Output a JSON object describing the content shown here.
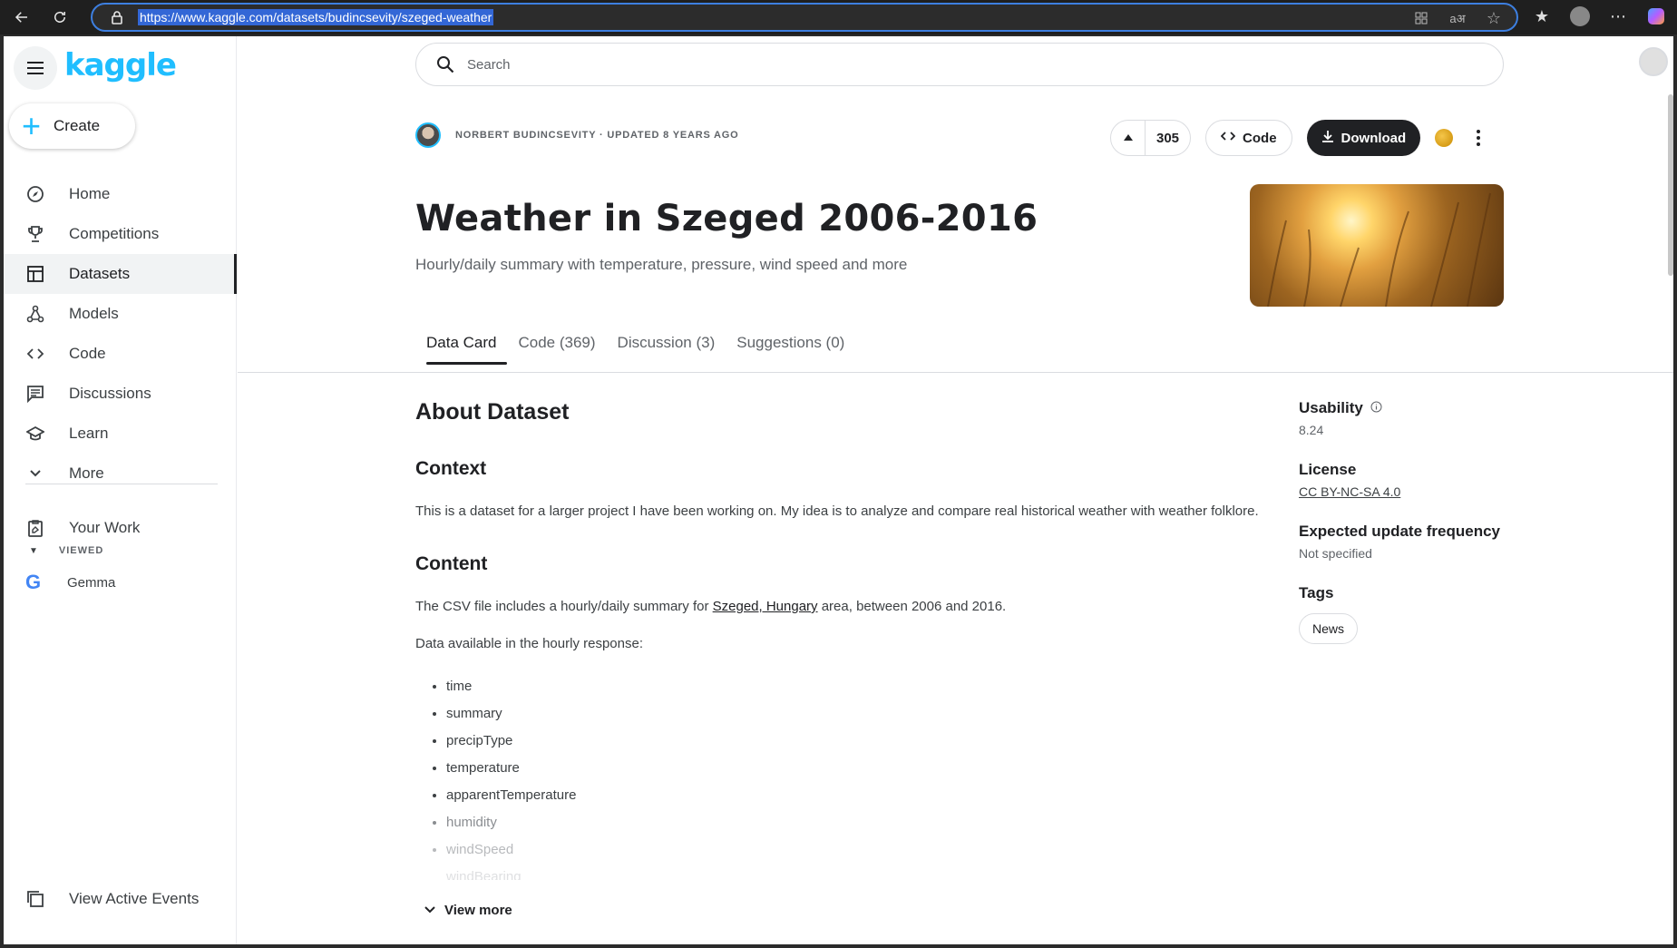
{
  "browser": {
    "url": "https://www.kaggle.com/datasets/budincsevity/szeged-weather"
  },
  "sidebar": {
    "logo": "kaggle",
    "create_label": "Create",
    "items": [
      {
        "label": "Home",
        "icon": "compass-icon"
      },
      {
        "label": "Competitions",
        "icon": "trophy-icon"
      },
      {
        "label": "Datasets",
        "icon": "table-icon",
        "active": true
      },
      {
        "label": "Models",
        "icon": "models-icon"
      },
      {
        "label": "Code",
        "icon": "code-icon"
      },
      {
        "label": "Discussions",
        "icon": "discussion-icon"
      },
      {
        "label": "Learn",
        "icon": "school-icon"
      },
      {
        "label": "More",
        "icon": "chevron-down-icon"
      }
    ],
    "your_work": "Your Work",
    "viewed_label": "VIEWED",
    "viewed_item": "Gemma",
    "active_events": "View Active Events"
  },
  "search": {
    "placeholder": "Search"
  },
  "dataset": {
    "owner_line": "NORBERT BUDINCSEVITY · UPDATED 8 YEARS AGO",
    "votes": "305",
    "code_label": "Code",
    "download_label": "Download",
    "title": "Weather in Szeged 2006-2016",
    "subtitle": "Hourly/daily summary with temperature, pressure, wind speed and more"
  },
  "tabs": [
    "Data Card",
    "Code (369)",
    "Discussion (3)",
    "Suggestions (0)"
  ],
  "about": {
    "heading": "About Dataset",
    "context_heading": "Context",
    "context_text": "This is a dataset for a larger project I have been working on. My idea is to analyze and compare real historical weather with weather folklore.",
    "content_heading": "Content",
    "content_pre": "The CSV file includes a hourly/daily summary for ",
    "content_link": "Szeged, Hungary",
    "content_post": " area, between 2006 and 2016.",
    "hourly_intro": "Data available in the hourly response:",
    "fields": [
      "time",
      "summary",
      "precipType",
      "temperature",
      "apparentTemperature",
      "humidity",
      "windSpeed",
      "windBearing"
    ],
    "view_more": "View more"
  },
  "meta": {
    "usability_label": "Usability",
    "usability_value": "8.24",
    "license_label": "License",
    "license_value": "CC BY-NC-SA 4.0",
    "frequency_label": "Expected update frequency",
    "frequency_value": "Not specified",
    "tags_label": "Tags",
    "tag": "News"
  }
}
